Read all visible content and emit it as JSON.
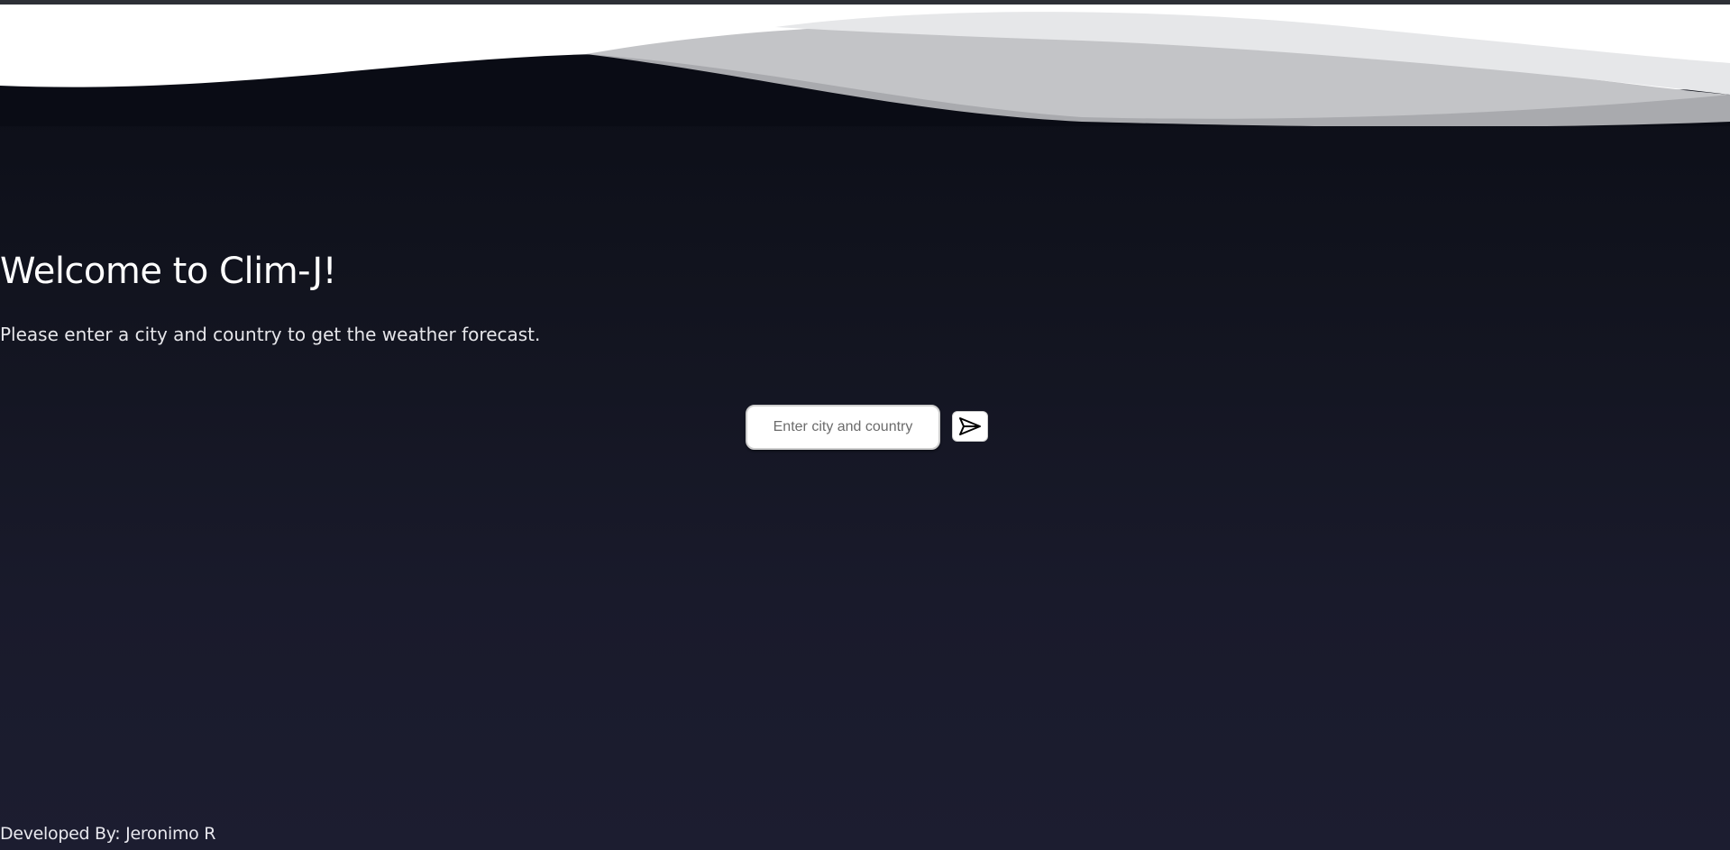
{
  "header": {
    "title": "Welcome to Clim-J!",
    "subtitle": "Please enter a city and country to get the weather forecast."
  },
  "search": {
    "value": "",
    "placeholder": "Enter city and country",
    "submit_icon": "send-icon"
  },
  "footer": {
    "credit": "Developed By: Jeronimo R"
  },
  "colors": {
    "background_top": "#0a0c15",
    "background_bottom": "#1c1d30",
    "text": "#ffffff",
    "wave_light": "#e6e7e9",
    "wave_mid": "#c9cacd",
    "wave_dark": "#a9aaae"
  }
}
